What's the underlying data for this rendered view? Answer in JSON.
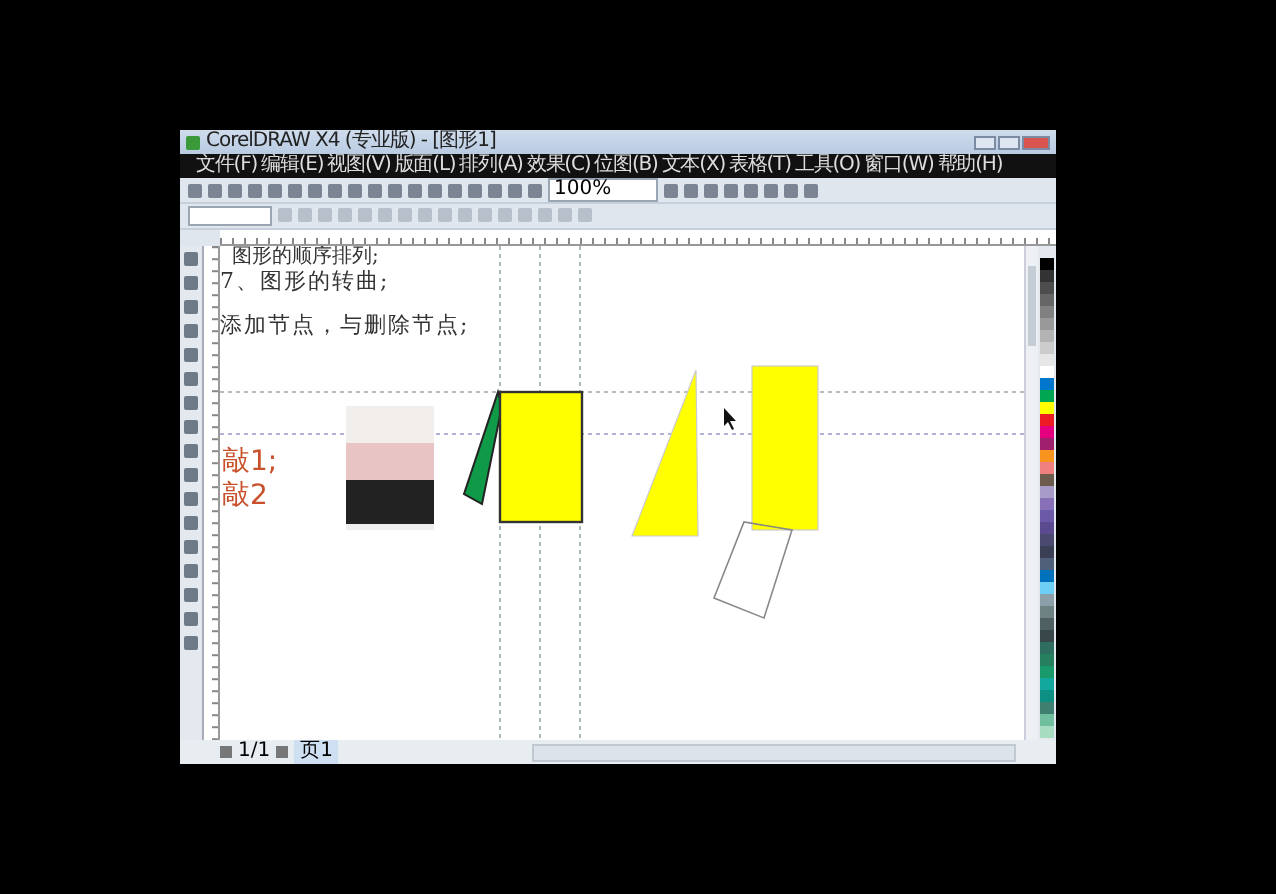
{
  "window": {
    "title": "CorelDRAW X4 (专业版) - [图形1]"
  },
  "menu": [
    "文件(F)",
    "编辑(E)",
    "视图(V)",
    "版面(L)",
    "排列(A)",
    "效果(C)",
    "位图(B)",
    "文本(X)",
    "表格(T)",
    "工具(O)",
    "窗口(W)",
    "帮助(H)"
  ],
  "toolbar": {
    "zoom": "100%"
  },
  "canvas": {
    "texts": [
      {
        "text": "图形的顺序排列;",
        "kind": "small"
      },
      {
        "text": "7、图形的转曲;",
        "kind": "normal"
      },
      {
        "text": "添加节点，与删除节点;",
        "kind": "normal"
      }
    ],
    "labels": [
      "敲1;",
      "敲2"
    ]
  },
  "palette": [
    {
      "color": "#000000"
    },
    {
      "color": "#333333"
    },
    {
      "color": "#4d4d4d"
    },
    {
      "color": "#666666"
    },
    {
      "color": "#808080"
    },
    {
      "color": "#999999"
    },
    {
      "color": "#b3b3b3"
    },
    {
      "color": "#cccccc"
    },
    {
      "color": "#e6e6e6"
    },
    {
      "color": "#ffffff"
    },
    {
      "color": "#0077cc"
    },
    {
      "color": "#00a651"
    },
    {
      "color": "#ffff00"
    },
    {
      "color": "#ed1c24"
    },
    {
      "color": "#e4007f"
    },
    {
      "color": "#a0206e"
    },
    {
      "color": "#f7941d"
    },
    {
      "color": "#f08080"
    },
    {
      "color": "#6d5c4d"
    },
    {
      "color": "#a99bc9"
    },
    {
      "color": "#8870b8"
    },
    {
      "color": "#6a5aa8"
    },
    {
      "color": "#5b4a8f"
    },
    {
      "color": "#4a4a70"
    },
    {
      "color": "#3a3f55"
    },
    {
      "color": "#50607a"
    },
    {
      "color": "#0072bc"
    },
    {
      "color": "#6dcff6"
    },
    {
      "color": "#8ba0a8"
    },
    {
      "color": "#6f8283"
    },
    {
      "color": "#4f6062"
    },
    {
      "color": "#37474a"
    },
    {
      "color": "#2f6e5e"
    },
    {
      "color": "#24805e"
    },
    {
      "color": "#1a9a6a"
    },
    {
      "color": "#13a89e"
    },
    {
      "color": "#0e8f84"
    },
    {
      "color": "#3f7f70"
    },
    {
      "color": "#6fbf9f"
    },
    {
      "color": "#a8dcc0"
    }
  ],
  "status": {
    "page_count": "1/1",
    "page_tab": "页1"
  }
}
